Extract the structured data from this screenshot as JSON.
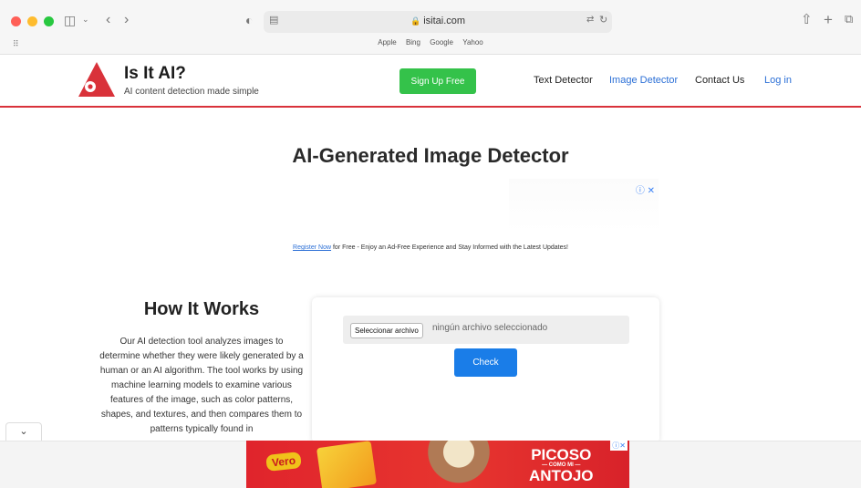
{
  "browser": {
    "url": "isitai.com",
    "favorites": [
      "Apple",
      "Bing",
      "Google",
      "Yahoo"
    ]
  },
  "header": {
    "brand_title": "Is It AI?",
    "brand_tagline": "AI content detection made simple",
    "signup_label": "Sign Up Free",
    "nav": {
      "text_detector": "Text Detector",
      "image_detector": "Image Detector",
      "contact": "Contact Us",
      "login": "Log in"
    }
  },
  "main": {
    "title": "AI-Generated Image Detector",
    "promo_link": "Register Now",
    "promo_text": " for Free - Enjoy an Ad-Free Experience and Stay Informed with the Latest Updates!",
    "how_title": "How It Works",
    "how_text": "Our AI detection tool analyzes images to determine whether they were likely generated by a human or an AI algorithm. The tool works by using machine learning models to examine various features of the image, such as color patterns, shapes, and textures, and then compares them to patterns typically found in",
    "file_button": "Seleccionar archivo",
    "file_status": "ningún archivo seleccionado",
    "check_label": "Check"
  },
  "ad": {
    "brand": "Vero",
    "headline_top": "PICOSO",
    "headline_mid": "— COMO MI —",
    "headline_bottom": "ANTOJO"
  },
  "colors": {
    "brand_red": "#d9323a",
    "signup_green": "#34c24a",
    "check_blue": "#1a7de8",
    "link_blue": "#2b6fd6"
  }
}
